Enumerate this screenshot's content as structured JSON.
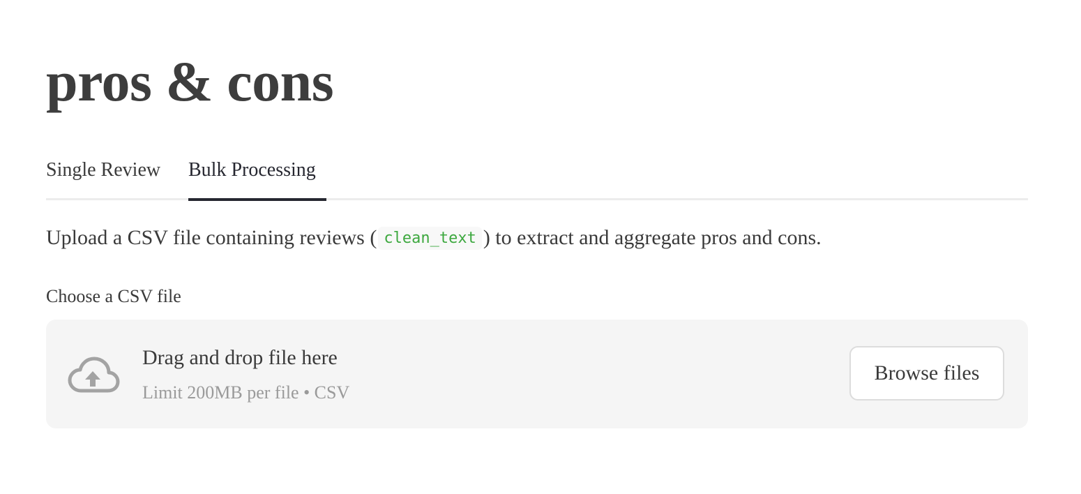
{
  "header": {
    "title": "pros & cons"
  },
  "tabs": [
    {
      "label": "Single Review",
      "active": false
    },
    {
      "label": "Bulk Processing",
      "active": true
    }
  ],
  "description": {
    "prefix": "Upload a CSV file containing reviews (",
    "code": "clean_text",
    "suffix": ") to extract and aggregate pros and cons."
  },
  "uploader": {
    "label": "Choose a CSV file",
    "drop_title": "Drag and drop file here",
    "limit_text": "Limit 200MB per file • CSV",
    "browse_label": "Browse files",
    "icon": "cloud-upload-icon"
  },
  "colors": {
    "title": "#3d3d3d",
    "active_tab_indicator": "#262730",
    "code_text": "#3da83f",
    "dropzone_bg": "#f5f5f5",
    "muted_text": "#9a9a9a"
  }
}
